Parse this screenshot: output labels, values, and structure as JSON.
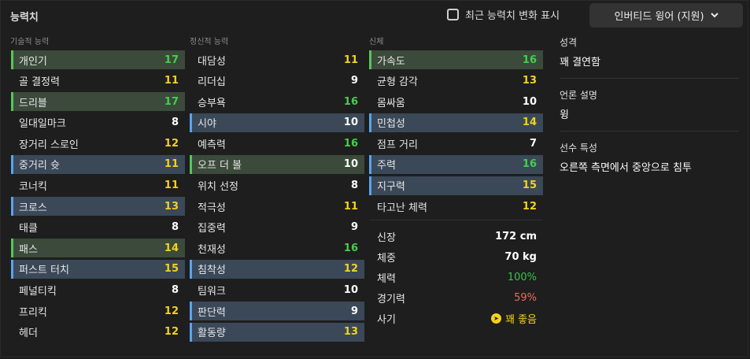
{
  "title": "능력치",
  "recent_toggle": {
    "label": "최근 능력치 변화 표시"
  },
  "role_select": {
    "label": "인버티드 윙어 (지원)"
  },
  "technical": {
    "heading": "기술적 능력",
    "items": [
      {
        "name": "개인기",
        "value": "17",
        "hl": "green",
        "color": "green"
      },
      {
        "name": "골 결정력",
        "value": "11",
        "hl": "",
        "color": "yellow"
      },
      {
        "name": "드리블",
        "value": "17",
        "hl": "green",
        "color": "green"
      },
      {
        "name": "일대일마크",
        "value": "8",
        "hl": "",
        "color": "white"
      },
      {
        "name": "장거리 스로인",
        "value": "12",
        "hl": "",
        "color": "yellow"
      },
      {
        "name": "중거리 슛",
        "value": "11",
        "hl": "blue",
        "color": "yellow"
      },
      {
        "name": "코너킥",
        "value": "11",
        "hl": "",
        "color": "yellow"
      },
      {
        "name": "크로스",
        "value": "13",
        "hl": "blue",
        "color": "yellow"
      },
      {
        "name": "태클",
        "value": "8",
        "hl": "",
        "color": "white"
      },
      {
        "name": "패스",
        "value": "14",
        "hl": "green",
        "color": "yellow"
      },
      {
        "name": "퍼스트 터치",
        "value": "15",
        "hl": "blue",
        "color": "yellow"
      },
      {
        "name": "페널티킥",
        "value": "8",
        "hl": "",
        "color": "white"
      },
      {
        "name": "프리킥",
        "value": "12",
        "hl": "",
        "color": "yellow"
      },
      {
        "name": "헤더",
        "value": "12",
        "hl": "",
        "color": "yellow"
      }
    ]
  },
  "mental": {
    "heading": "정신적 능력",
    "items": [
      {
        "name": "대담성",
        "value": "11",
        "hl": "",
        "color": "yellow"
      },
      {
        "name": "리더십",
        "value": "9",
        "hl": "",
        "color": "white"
      },
      {
        "name": "승부욕",
        "value": "16",
        "hl": "",
        "color": "green"
      },
      {
        "name": "시야",
        "value": "10",
        "hl": "blue",
        "color": "white"
      },
      {
        "name": "예측력",
        "value": "16",
        "hl": "",
        "color": "green"
      },
      {
        "name": "오프 더 볼",
        "value": "10",
        "hl": "green",
        "color": "white"
      },
      {
        "name": "위치 선정",
        "value": "8",
        "hl": "",
        "color": "white"
      },
      {
        "name": "적극성",
        "value": "11",
        "hl": "",
        "color": "yellow"
      },
      {
        "name": "집중력",
        "value": "9",
        "hl": "",
        "color": "white"
      },
      {
        "name": "천재성",
        "value": "16",
        "hl": "",
        "color": "green"
      },
      {
        "name": "침착성",
        "value": "12",
        "hl": "blue",
        "color": "yellow"
      },
      {
        "name": "팀워크",
        "value": "10",
        "hl": "",
        "color": "white"
      },
      {
        "name": "판단력",
        "value": "9",
        "hl": "blue",
        "color": "white"
      },
      {
        "name": "활동량",
        "value": "13",
        "hl": "blue",
        "color": "yellow"
      }
    ]
  },
  "physical": {
    "heading": "신체",
    "items": [
      {
        "name": "가속도",
        "value": "16",
        "hl": "green",
        "color": "green"
      },
      {
        "name": "균형 감각",
        "value": "13",
        "hl": "",
        "color": "yellow"
      },
      {
        "name": "몸싸움",
        "value": "10",
        "hl": "",
        "color": "white"
      },
      {
        "name": "민첩성",
        "value": "14",
        "hl": "blue",
        "color": "yellow"
      },
      {
        "name": "점프 거리",
        "value": "7",
        "hl": "",
        "color": "white"
      },
      {
        "name": "주력",
        "value": "16",
        "hl": "blue",
        "color": "green"
      },
      {
        "name": "지구력",
        "value": "15",
        "hl": "blue",
        "color": "yellow"
      },
      {
        "name": "타고난 체력",
        "value": "12",
        "hl": "",
        "color": "yellow"
      }
    ]
  },
  "info": {
    "height": {
      "label": "신장",
      "value": "172 cm"
    },
    "weight": {
      "label": "체중",
      "value": "70 kg"
    },
    "condition": {
      "label": "체력",
      "value": "100%"
    },
    "sharpness": {
      "label": "경기력",
      "value": "59%"
    },
    "morale": {
      "label": "사기",
      "value": "꽤 좋음"
    }
  },
  "personality": {
    "label": "성격",
    "value": "꽤 결연함"
  },
  "media": {
    "label": "언론 설명",
    "value": "윙"
  },
  "traits": {
    "label": "선수 특성",
    "value": "오른쪽 측면에서 중앙으로 침투"
  },
  "colors": {
    "green_hl": "#3b4a3a",
    "blue_hl": "#3a4858",
    "green_bar": "#58c45c",
    "blue_bar": "#5aa3ee",
    "yellow": "#f2d21e",
    "green": "#43d04b",
    "white": "#ffffff"
  }
}
